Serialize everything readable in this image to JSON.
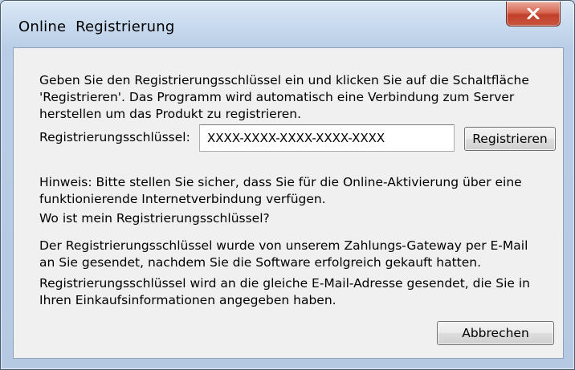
{
  "window": {
    "title": "Online  Registrierung"
  },
  "dialog": {
    "intro_lines": [
      "Geben Sie den Registrierungsschlüssel ein und klicken Sie auf die Schaltfläche",
      "'Registrieren'. Das Programm wird automatisch eine Verbindung zum Server",
      "herstellen um das Produkt zu registrieren."
    ],
    "key_label": "Registrierungsschlüssel:",
    "key_value": "XXXX-XXXX-XXXX-XXXX-XXXX",
    "register_label": "Registrieren",
    "hinweis_lines": [
      "Hinweis: Bitte stellen Sie sicher, dass Sie für die Online-Aktivierung über eine",
      "funktionierende Internetverbindung verfügen."
    ],
    "where_question": "Wo ist mein Registrierungsschlüssel?",
    "sent_lines": [
      "Der Registrierungsschlüssel wurde von unserem Zahlungs-Gateway per E-Mail",
      "an Sie gesendet, nachdem Sie die Software erfolgreich gekauft hatten."
    ],
    "address_lines": [
      "Registrierungsschlüssel wird an die gleiche E-Mail-Adresse gesendet, die Sie in",
      "Ihren Einkaufsinformationen angegeben haben."
    ],
    "cancel_label": "Abbrechen"
  },
  "icons": {
    "close": "close-icon"
  }
}
